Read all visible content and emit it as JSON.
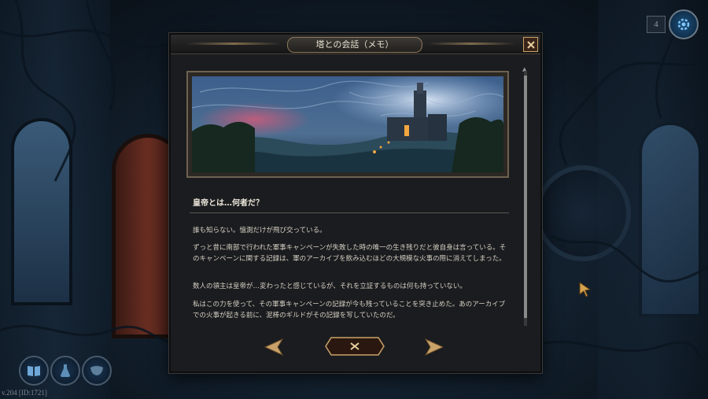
{
  "dialog": {
    "title": "塔との会話（メモ）",
    "heading": "皇帝とは…何者だ？",
    "paragraphs": [
      "誰も知らない。憶測だけが飛び交っている。",
      "ずっと昔に南部で行われた軍事キャンペーンが失敗した時の唯一の生き残りだと彼自身は言っている。そのキャンペーンに関する記録は、軍のアーカイブを飲み込むほどの大規模な火事の際に消えてしまった。",
      "数人の領主は皇帝が…変わったと感じているが、それを立証するものは何も持っていない。",
      "私はこの力を使って、その軍事キャンペーンの記録が今も残っていることを突き止めた。あのアーカイブでの火事が起きる前に、泥棒のギルドがその記録を写していたのだ。"
    ]
  },
  "hud": {
    "counter": "4",
    "version": "v.204 [ID:1721]"
  },
  "icons": {
    "close": "close-x-icon",
    "prev": "arrow-left-icon",
    "next": "arrow-right-icon",
    "gear": "gear-icon",
    "journal": "book-icon",
    "potion": "potion-icon",
    "mask": "mask-icon"
  },
  "colors": {
    "accent_gold": "#c9a26a",
    "panel": "#1b1c1f",
    "text": "#d6d0c4"
  }
}
